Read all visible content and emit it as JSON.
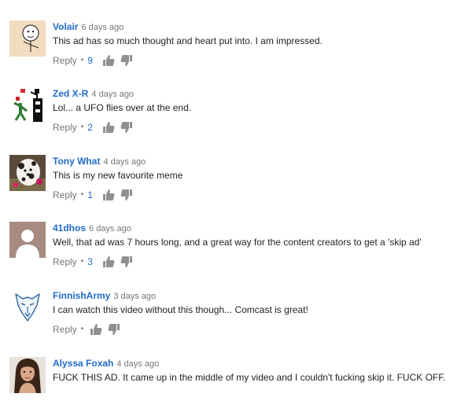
{
  "comments": [
    {
      "author": "Volair",
      "time": "6 days ago",
      "text": "This ad has so much thought and heart put into.  I am impressed.",
      "reply_label": "Reply",
      "separator": "•",
      "likes": "9",
      "avatar_icon": "cartoon-face-icon"
    },
    {
      "author": "Zed X-R",
      "time": "4 days ago",
      "text": "Lol... a UFO flies over at the end.",
      "reply_label": "Reply",
      "separator": "•",
      "likes": "2",
      "avatar_icon": "pixel-figures-icon"
    },
    {
      "author": "Tony What",
      "time": "4 days ago",
      "text": "This is my new favourite meme",
      "reply_label": "Reply",
      "separator": "•",
      "likes": "1",
      "avatar_icon": "dog-photo-icon"
    },
    {
      "author": "41dhos",
      "time": "6 days ago",
      "text": "Well, that ad was 7 hours long, and a great way for the content creators to get a 'skip ad'",
      "reply_label": "Reply",
      "separator": "•",
      "likes": "3",
      "avatar_icon": "default-user-icon"
    },
    {
      "author": "FinnishArmy",
      "time": "3 days ago",
      "text": "I can watch this video without this though... Comcast is great!",
      "reply_label": "Reply",
      "separator": "•",
      "likes": "",
      "avatar_icon": "wolf-logo-icon"
    },
    {
      "author": "Alyssa Foxah",
      "time": "4 days ago",
      "text": "FUCK THIS AD. It came up in the middle of my video and I couldn't fucking skip it. FUCK OFF.",
      "reply_label": "",
      "separator": "",
      "likes": "",
      "avatar_icon": "person-photo-icon"
    }
  ],
  "colors": {
    "author": "#1f6bc7",
    "like_count": "#1f6bc7",
    "meta_gray": "#767676",
    "text": "#222222",
    "icon": "#909090"
  }
}
